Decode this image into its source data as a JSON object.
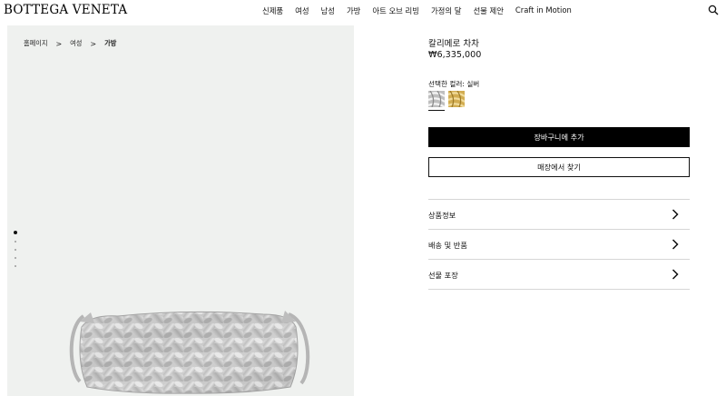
{
  "header": {
    "logo": "BOTTEGA VENETA",
    "nav": [
      "신제품",
      "여성",
      "남성",
      "가방",
      "아트 오브 리빙",
      "가정의 달",
      "선물 제안",
      "Craft in Motion"
    ],
    "search_icon": "search-icon"
  },
  "breadcrumb": {
    "items": [
      "홈페이지",
      "여성",
      "가방"
    ],
    "separator": ">"
  },
  "gallery": {
    "image_count": 5,
    "active_index": 0,
    "image_subject": "bag-image"
  },
  "product": {
    "name": "칼리메로 차차",
    "price": "₩6,335,000",
    "color_label": "선택한 컬러: 실버",
    "swatches": [
      {
        "name": "silver-swatch",
        "color": "#c8c8c8",
        "selected": true
      },
      {
        "name": "gold-swatch",
        "color": "#d6b45a",
        "selected": false
      }
    ],
    "add_to_cart": "장바구니에 추가",
    "find_in_store": "매장에서 찾기"
  },
  "accordion": {
    "items": [
      "상품정보",
      "배송 및 반품",
      "선물 포장"
    ],
    "chevron_icon": "chevron-right-icon"
  },
  "colors": {
    "panel_bg": "#eff1ef",
    "primary_button": "#000000",
    "divider": "#d6d6d6"
  }
}
